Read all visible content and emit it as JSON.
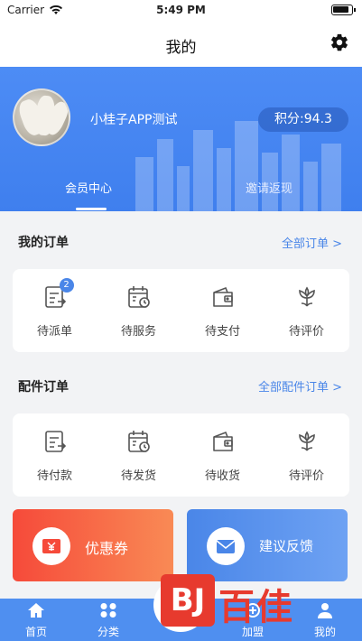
{
  "status_bar": {
    "carrier": "Carrier",
    "time": "5:49 PM"
  },
  "nav": {
    "title": "我的",
    "settings_icon": "gear-icon"
  },
  "profile": {
    "username": "小桂子APP测试",
    "points_label": "积分:94.3",
    "tabs": [
      {
        "label": "会员中心",
        "active": true
      },
      {
        "label": "邀请返现",
        "active": false
      }
    ]
  },
  "my_orders": {
    "title": "我的订单",
    "link": "全部订单 >",
    "items": [
      {
        "label": "待派单",
        "icon": "dispatch-icon",
        "badge": "2"
      },
      {
        "label": "待服务",
        "icon": "calendar-clock-icon"
      },
      {
        "label": "待支付",
        "icon": "wallet-icon"
      },
      {
        "label": "待评价",
        "icon": "review-flower-icon"
      }
    ]
  },
  "parts_orders": {
    "title": "配件订单",
    "link": "全部配件订单 >",
    "items": [
      {
        "label": "待付款",
        "icon": "payment-doc-icon"
      },
      {
        "label": "待发货",
        "icon": "calendar-clock-icon"
      },
      {
        "label": "待收货",
        "icon": "wallet-icon"
      },
      {
        "label": "待评价",
        "icon": "review-flower-icon"
      }
    ]
  },
  "promos": {
    "coupon": {
      "label": "优惠券",
      "icon": "coupon-icon",
      "color": "#f64a3a"
    },
    "feedback": {
      "label": "建议反馈",
      "icon": "mail-icon",
      "color": "#4a86e8"
    }
  },
  "tabbar": {
    "items": [
      {
        "label": "首页",
        "icon": "home-icon"
      },
      {
        "label": "分类",
        "icon": "grid-icon"
      },
      {
        "label": "加盟",
        "icon": "join-icon"
      },
      {
        "label": "我的",
        "icon": "user-icon"
      }
    ]
  },
  "watermark": {
    "mark": "BJ",
    "text": "百佳"
  },
  "colors": {
    "accent": "#4a86e8",
    "header": "#4d8cf5",
    "coupon": "#f64a3a"
  }
}
